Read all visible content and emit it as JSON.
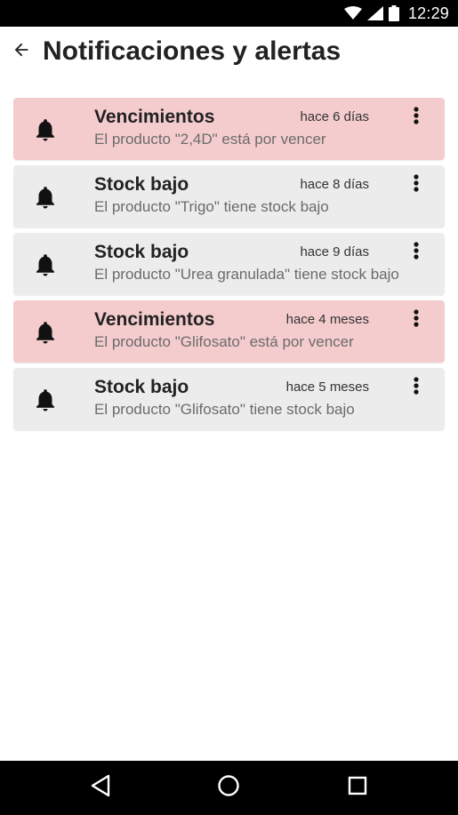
{
  "status_bar": {
    "time": "12:29",
    "icons": [
      "wifi-icon",
      "signal-icon",
      "battery-icon"
    ]
  },
  "header": {
    "title": "Notificaciones y alertas",
    "back_icon": "arrow-left-icon"
  },
  "notifications": [
    {
      "type": "alert",
      "title": "Vencimientos",
      "time": "hace 6 días",
      "message": "El producto \"2,4D\" está por vencer",
      "icon": "bell-icon"
    },
    {
      "type": "normal",
      "title": "Stock bajo",
      "time": "hace 8 días",
      "message": "El producto \"Trigo\" tiene stock bajo",
      "icon": "bell-icon"
    },
    {
      "type": "normal",
      "title": "Stock bajo",
      "time": "hace 9 días",
      "message": "El producto \"Urea granulada\" tiene stock bajo",
      "icon": "bell-icon"
    },
    {
      "type": "alert",
      "title": "Vencimientos",
      "time": "hace 4 meses",
      "message": "El producto \"Glifosato\" está por vencer",
      "icon": "bell-icon"
    },
    {
      "type": "normal",
      "title": "Stock bajo",
      "time": "hace 5 meses",
      "message": "El producto \"Glifosato\" tiene stock bajo",
      "icon": "bell-icon"
    }
  ],
  "colors": {
    "alert_card": "#f5cccd",
    "normal_card": "#ececec",
    "title_text": "#222222",
    "message_text": "#6b6b6b",
    "system_bars": "#000000"
  },
  "nav_bar": {
    "icons": [
      "nav-back-icon",
      "nav-home-icon",
      "nav-recents-icon"
    ]
  }
}
